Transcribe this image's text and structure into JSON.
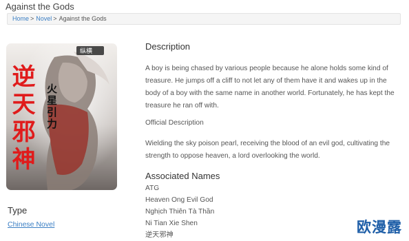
{
  "page": {
    "title": "Against the Gods"
  },
  "breadcrumb": {
    "items": [
      {
        "label": "Home",
        "link": true
      },
      {
        "label": "Novel",
        "link": true
      },
      {
        "label": "Against the Gods",
        "link": false
      }
    ],
    "separator": ">"
  },
  "cover": {
    "alt": "Book cover",
    "calligraphy_main": "逆天邪神",
    "calligraphy_side": "火星引力",
    "publisher_mark": "纵横"
  },
  "description": {
    "heading": "Description",
    "text": "A boy is being chased by various people because he alone holds some kind of treasure. He jumps off a cliff to not let any of them have it and wakes up in the body of a boy with the same name in another world. Fortunately, he has kept the treasure he ran off with."
  },
  "official_description": {
    "heading": "Official Description",
    "text": "Wielding the sky poison pearl, receiving the blood of an evil god, cultivating the strength to oppose heaven, a lord overlooking the world."
  },
  "associated_names": {
    "heading": "Associated Names",
    "items": [
      "ATG",
      "Heaven Ong Evil God",
      "Nghịch Thiên Tà Thần",
      "Ni Tian Xie Shen",
      "逆天邪神"
    ]
  },
  "type": {
    "heading": "Type",
    "value": "Chinese Novel"
  },
  "watermark": {
    "text": "欧漫露"
  },
  "colors": {
    "link": "#3b7fc4",
    "watermark": "#1f5fa8",
    "calligraphy": "#e01b1b"
  }
}
